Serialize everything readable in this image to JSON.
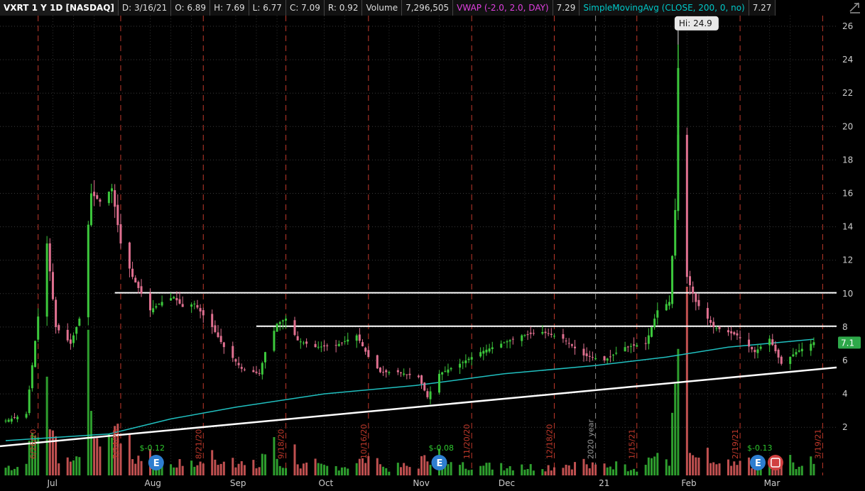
{
  "header": {
    "symbol": "VXRT 1 Y 1D [NASDAQ]",
    "date": "D: 3/16/21",
    "open": "O: 6.89",
    "high": "H: 7.69",
    "low": "L: 6.77",
    "close": "C: 7.09",
    "range": "R: 0.92",
    "volume_label": "Volume",
    "volume_value": "7,296,505",
    "vwap_label": "VWAP (-2.0, 2.0, DAY)",
    "vwap_value": "7.29",
    "sma_label": "SimpleMovingAvg (CLOSE, 200, 0, no)",
    "sma_value": "7.27"
  },
  "chart_data": {
    "type": "candlestick",
    "y_ticks": [
      "2",
      "4",
      "6",
      "8",
      "10",
      "12",
      "14",
      "16",
      "18",
      "20",
      "22",
      "24",
      "26"
    ],
    "ylim": [
      0,
      27
    ],
    "x_ticks": [
      "Jul",
      "Aug",
      "Sep",
      "Oct",
      "Nov",
      "Dec",
      "21",
      "Feb",
      "Mar"
    ],
    "date_markers": [
      "6/26/20",
      "7/24/20",
      "8/21/20",
      "9/18/20",
      "10/16/20",
      "11/20/20",
      "12/18/20",
      "2020 year",
      "1/15/21",
      "2/19/21",
      "3/19/21"
    ],
    "current_price_label": "7.1",
    "high_annotation": "Hi: 24.9",
    "dividend_labels": [
      "$-0.12",
      "$-0.08",
      "$-0.13"
    ],
    "horizontal_lines": [
      {
        "price": 10.05,
        "start_date": "7/22/20"
      },
      {
        "price": 8.05,
        "start_date": "9/8/20"
      }
    ],
    "trendline": {
      "start": [
        "6/15/20",
        0.9
      ],
      "end": [
        "3/19/21",
        5.5
      ]
    },
    "sma_line": [
      [
        "6/15/20",
        1.2
      ],
      [
        "7/20/20",
        1.6
      ],
      [
        "8/10/20",
        2.5
      ],
      [
        "9/1/20",
        3.2
      ],
      [
        "10/1/20",
        4.0
      ],
      [
        "11/1/20",
        4.5
      ],
      [
        "12/1/20",
        5.2
      ],
      [
        "1/1/21",
        5.7
      ],
      [
        "1/25/21",
        6.2
      ],
      [
        "2/15/21",
        6.8
      ],
      [
        "3/16/21",
        7.27
      ]
    ],
    "price_path": [
      [
        "6/15/20",
        2.4
      ],
      [
        "6/22/20",
        2.8
      ],
      [
        "6/29/20",
        13.0
      ],
      [
        "7/2/20",
        8.0
      ],
      [
        "7/7/20",
        7.0
      ],
      [
        "7/10/20",
        8.5
      ],
      [
        "7/14/20",
        16.0
      ],
      [
        "7/17/20",
        15.5
      ],
      [
        "7/21/20",
        16.3
      ],
      [
        "7/24/20",
        13.0
      ],
      [
        "7/28/20",
        11.0
      ],
      [
        "8/3/20",
        9.0
      ],
      [
        "8/7/20",
        9.5
      ],
      [
        "8/11/20",
        9.8
      ],
      [
        "8/14/20",
        9.2
      ],
      [
        "8/18/20",
        9.4
      ],
      [
        "8/24/20",
        8.0
      ],
      [
        "8/28/20",
        6.8
      ],
      [
        "9/3/20",
        5.5
      ],
      [
        "9/9/20",
        5.2
      ],
      [
        "9/11/20",
        6.5
      ],
      [
        "9/15/20",
        8.2
      ],
      [
        "9/18/20",
        8.5
      ],
      [
        "9/22/20",
        7.2
      ],
      [
        "9/28/20",
        6.8
      ],
      [
        "10/5/20",
        6.9
      ],
      [
        "10/12/20",
        7.5
      ],
      [
        "10/16/20",
        6.2
      ],
      [
        "10/20/20",
        5.3
      ],
      [
        "10/26/20",
        5.3
      ],
      [
        "11/2/20",
        5.0
      ],
      [
        "11/5/20",
        3.8
      ],
      [
        "11/9/20",
        5.2
      ],
      [
        "11/16/20",
        5.8
      ],
      [
        "11/23/20",
        6.5
      ],
      [
        "11/30/20",
        7.0
      ],
      [
        "12/7/20",
        7.5
      ],
      [
        "12/14/20",
        7.7
      ],
      [
        "12/21/20",
        7.3
      ],
      [
        "12/28/20",
        6.3
      ],
      [
        "1/4/21",
        6.0
      ],
      [
        "1/11/21",
        6.8
      ],
      [
        "1/18/21",
        7.0
      ],
      [
        "1/22/21",
        9.0
      ],
      [
        "1/26/21",
        9.5
      ],
      [
        "1/28/21",
        15.0
      ],
      [
        "1/29/21",
        19.5
      ],
      [
        "2/1/21",
        11.0
      ],
      [
        "2/4/21",
        9.5
      ],
      [
        "2/10/21",
        8.0
      ],
      [
        "2/18/21",
        7.5
      ],
      [
        "2/24/21",
        6.5
      ],
      [
        "3/1/21",
        7.3
      ],
      [
        "3/5/21",
        5.8
      ],
      [
        "3/10/21",
        6.5
      ],
      [
        "3/16/21",
        7.09
      ]
    ]
  }
}
